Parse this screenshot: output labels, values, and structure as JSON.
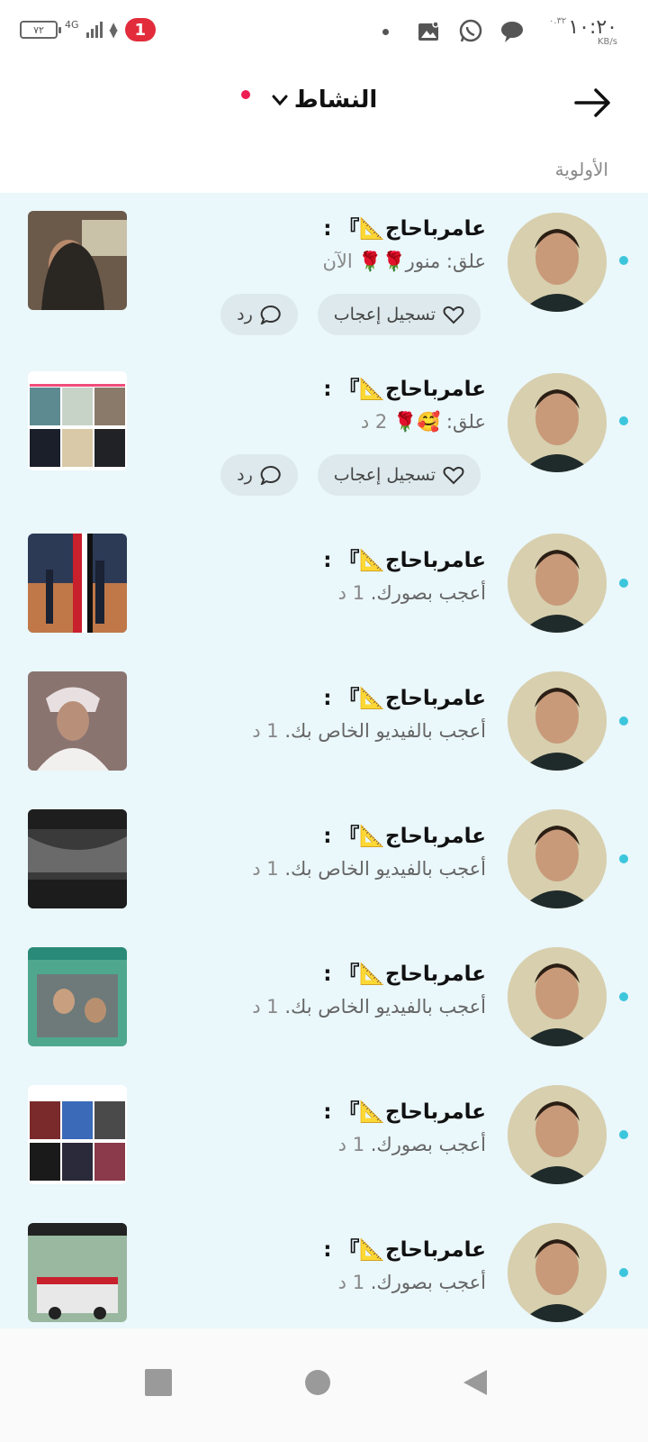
{
  "status_bar": {
    "battery": "٧٢",
    "network": "4G",
    "notification_count": "1",
    "time": "١٠:٢٠",
    "speed_value": "٠.٣٢",
    "speed_unit": "KB/s"
  },
  "header": {
    "title": "النشاط"
  },
  "section": {
    "label": "الأولوية"
  },
  "activity": [
    {
      "name": "عامرباحاج📐』 :",
      "desc": "علق: منور🌹🌹 ",
      "time": "الآن",
      "has_actions": true
    },
    {
      "name": "عامرباحاج📐』 :",
      "desc": "علق: 🥰🌹 ",
      "time": "2 د",
      "has_actions": true
    },
    {
      "name": "عامرباحاج📐』 :",
      "desc": "أعجب بصورك. ",
      "time": "1 د",
      "has_actions": false
    },
    {
      "name": "عامرباحاج📐』 :",
      "desc": "أعجب بالفيديو الخاص بك. ",
      "time": "1 د",
      "has_actions": false
    },
    {
      "name": "عامرباحاج📐』 :",
      "desc": "أعجب بالفيديو الخاص بك. ",
      "time": "1 د",
      "has_actions": false
    },
    {
      "name": "عامرباحاج📐』 :",
      "desc": "أعجب بالفيديو الخاص بك. ",
      "time": "1 د",
      "has_actions": false
    },
    {
      "name": "عامرباحاج📐』 :",
      "desc": "أعجب بصورك. ",
      "time": "1 د",
      "has_actions": false
    },
    {
      "name": "عامرباحاج📐』 :",
      "desc": "أعجب بصورك. ",
      "time": "1 د",
      "has_actions": false
    }
  ],
  "actions": {
    "like_label": "تسجيل إعجاب",
    "reply_label": "رد"
  },
  "colors": {
    "accent_dot": "#ee1d52",
    "unread_dot": "#3cc6dc",
    "list_bg": "#eaf7fb",
    "badge": "#e22c3c"
  }
}
